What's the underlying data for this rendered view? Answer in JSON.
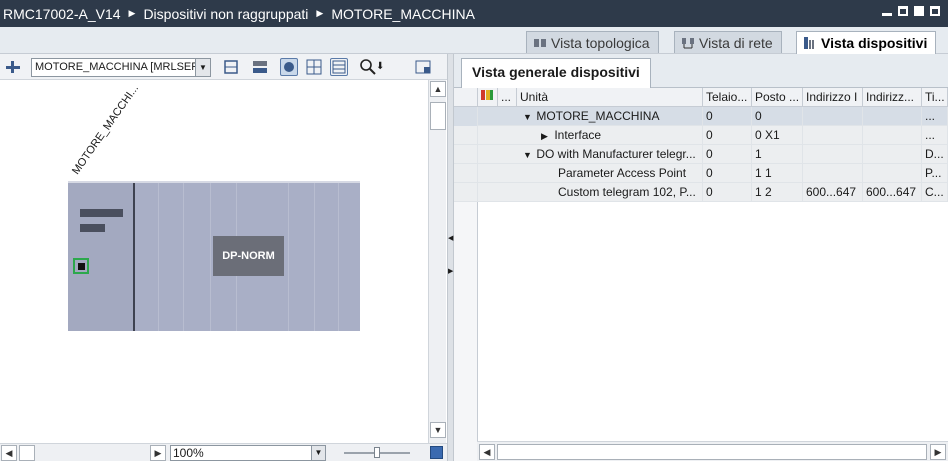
{
  "breadcrumb": {
    "project": "RMC17002-A_V14",
    "group": "Dispositivi non raggruppati",
    "device": "MOTORE_MACCHINA"
  },
  "view_tabs": [
    {
      "label": "Vista topologica",
      "icon": "topology-icon"
    },
    {
      "label": "Vista di rete",
      "icon": "network-icon"
    },
    {
      "label": "Vista dispositivi",
      "icon": "device-icon"
    }
  ],
  "left": {
    "device_select": "MOTORE_MACCHINA [MRLSERV",
    "device_label": "MOTORE_MACCHI...",
    "module_label": "DP-NORM",
    "zoom": "100%"
  },
  "right": {
    "tab_title": "Vista generale dispositivi",
    "columns": [
      "...",
      "Unità",
      "Telaio...",
      "Posto ...",
      "Indirizzo I",
      "Indirizz...",
      "Ti..."
    ],
    "rows": [
      {
        "indent": 0,
        "toggle": "▼",
        "unit": "MOTORE_MACCHINA",
        "rack": "0",
        "slot": "0",
        "addr_i": "",
        "addr_q": "",
        "type": "..."
      },
      {
        "indent": 1,
        "toggle": "▶",
        "unit": "Interface",
        "rack": "0",
        "slot": "0 X1",
        "addr_i": "",
        "addr_q": "",
        "type": "..."
      },
      {
        "indent": 0,
        "toggle": "▼",
        "unit": "DO with Manufacturer telegr...",
        "rack": "0",
        "slot": "1",
        "addr_i": "",
        "addr_q": "",
        "type": "D..."
      },
      {
        "indent": 2,
        "toggle": "",
        "unit": "Parameter Access Point",
        "rack": "0",
        "slot": "1 1",
        "addr_i": "",
        "addr_q": "",
        "type": "P..."
      },
      {
        "indent": 2,
        "toggle": "",
        "unit": "Custom telegram 102, P...",
        "rack": "0",
        "slot": "1 2",
        "addr_i": "600...647",
        "addr_q": "600...647",
        "type": "C..."
      }
    ]
  },
  "colors": {
    "titlebar": "#2e3a4a",
    "rack": "#a9afc6",
    "module": "#6b6e78",
    "port_highlight": "#2ca84c"
  }
}
